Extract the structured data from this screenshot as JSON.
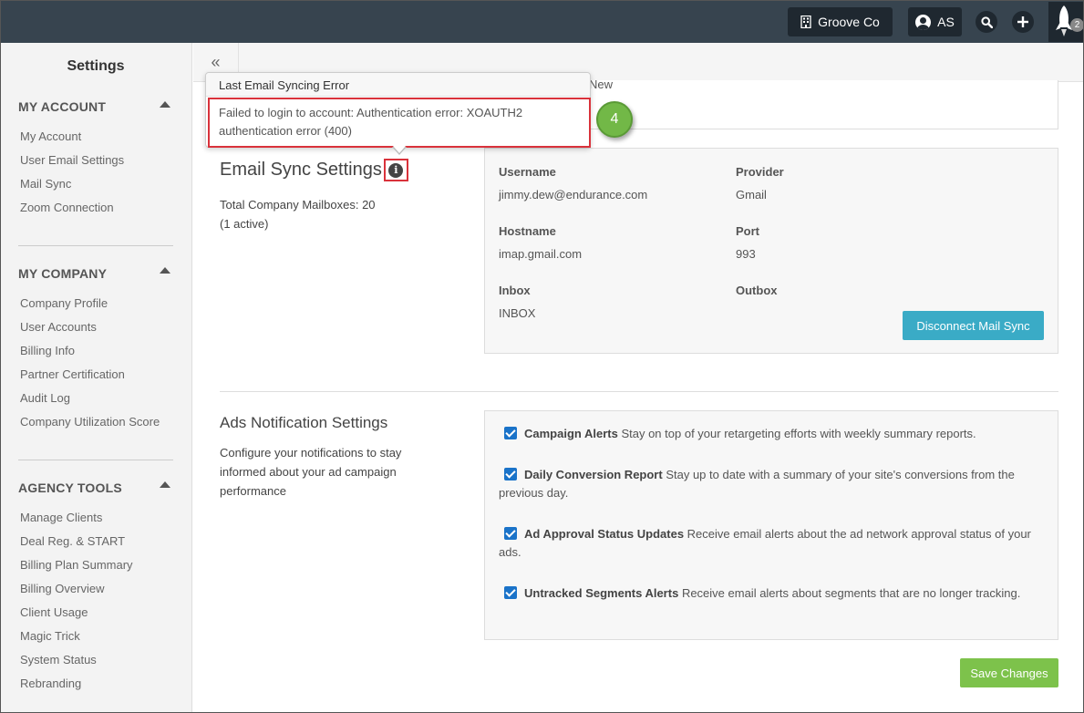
{
  "topbar": {
    "company": "Groove Co",
    "user_initials": "AS",
    "notification_count": "2"
  },
  "sidebar": {
    "title": "Settings",
    "sections": [
      {
        "heading": "MY ACCOUNT",
        "items": [
          "My Account",
          "User Email Settings",
          "Mail Sync",
          "Zoom Connection"
        ]
      },
      {
        "heading": "MY COMPANY",
        "items": [
          "Company Profile",
          "User Accounts",
          "Billing Info",
          "Partner Certification",
          "Audit Log",
          "Company Utilization Score"
        ]
      },
      {
        "heading": "AGENCY TOOLS",
        "items": [
          "Manage Clients",
          "Deal Reg. & START",
          "Billing Plan Summary",
          "Billing Overview",
          "Client Usage",
          "Magic Trick",
          "System Status",
          "Rebranding"
        ]
      }
    ]
  },
  "main": {
    "collapse_icon": "«",
    "partial_text": "New"
  },
  "popover": {
    "title": "Last Email Syncing Error",
    "body": "Failed to login to account: Authentication error: XOAUTH2 authentication error (400)"
  },
  "step_badge": "4",
  "email_sync": {
    "title": "Email Sync Settings",
    "mailboxes_line1": "Total Company Mailboxes: 20",
    "mailboxes_line2": "(1 active)",
    "fields": {
      "username_label": "Username",
      "username_value": "jimmy.dew@endurance.com",
      "provider_label": "Provider",
      "provider_value": "Gmail",
      "hostname_label": "Hostname",
      "hostname_value": "imap.gmail.com",
      "port_label": "Port",
      "port_value": "993",
      "inbox_label": "Inbox",
      "inbox_value": "INBOX",
      "outbox_label": "Outbox"
    },
    "disconnect_label": "Disconnect Mail Sync"
  },
  "ads": {
    "title": "Ads Notification Settings",
    "description": "Configure your notifications to stay informed about your ad campaign performance",
    "items": [
      {
        "name": "Campaign Alerts",
        "text": "Stay on top of your retargeting efforts with weekly summary reports.",
        "checked": true
      },
      {
        "name": "Daily Conversion Report",
        "text": "Stay up to date with a summary of your site's conversions from the previous day.",
        "checked": true
      },
      {
        "name": "Ad Approval Status Updates",
        "text": "Receive email alerts about the ad network approval status of your ads.",
        "checked": true
      },
      {
        "name": "Untracked Segments Alerts",
        "text": "Receive email alerts about segments that are no longer tracking.",
        "checked": true
      }
    ]
  },
  "save_label": "Save Changes",
  "colors": {
    "topbar": "#37444f",
    "disconnect_button": "#3aabc6",
    "save_button": "#7dc24b",
    "highlight_border": "#d9323b",
    "checkbox": "#1a73c9"
  }
}
